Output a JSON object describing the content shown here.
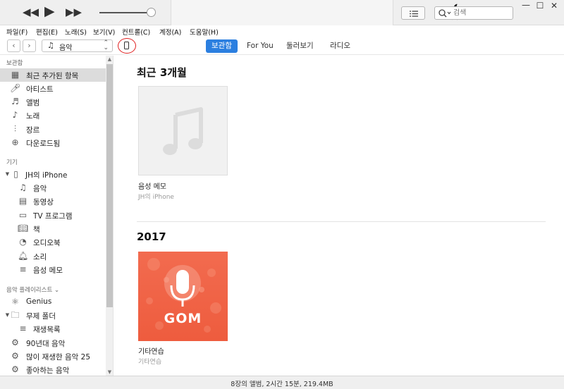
{
  "player": {
    "rewind_icon": "rewind-icon",
    "play_icon": "play-icon",
    "forward_icon": "fast-forward-icon",
    "volume_level": 0.9
  },
  "search": {
    "placeholder": "검색"
  },
  "window": {
    "minimize": "—",
    "maximize": "☐",
    "close": "✕"
  },
  "menu": [
    "파일(F)",
    "편집(E)",
    "노래(S)",
    "보기(V)",
    "컨트롤(C)",
    "계정(A)",
    "도움말(H)"
  ],
  "nav": {
    "back": "‹",
    "forward": "›",
    "media_type": "음악",
    "tabs": [
      "보관함",
      "For You",
      "둘러보기",
      "라디오"
    ],
    "active_tab": "보관함"
  },
  "sidebar": {
    "library_header": "보관함",
    "library_items": [
      {
        "label": "최근 추가된 항목",
        "icon": "grid-icon",
        "selected": true
      },
      {
        "label": "아티스트",
        "icon": "microphone-icon"
      },
      {
        "label": "앨범",
        "icon": "album-icon"
      },
      {
        "label": "노래",
        "icon": "music-note-icon"
      },
      {
        "label": "장르",
        "icon": "genre-icon"
      },
      {
        "label": "다운로드됨",
        "icon": "download-icon"
      }
    ],
    "devices_header": "기기",
    "device_name": "JH의 iPhone",
    "device_items": [
      {
        "label": "음악",
        "icon": "music-note-icon"
      },
      {
        "label": "동영상",
        "icon": "film-icon"
      },
      {
        "label": "TV 프로그램",
        "icon": "tv-icon"
      },
      {
        "label": "책",
        "icon": "book-icon"
      },
      {
        "label": "오디오북",
        "icon": "audiobook-icon"
      },
      {
        "label": "소리",
        "icon": "bell-icon"
      },
      {
        "label": "음성 메모",
        "icon": "voice-memo-icon"
      }
    ],
    "playlists_header": "음악 플레이리스트 ⌄",
    "playlist_items": [
      {
        "label": "Genius",
        "icon": "genius-icon"
      },
      {
        "label": "무제 폴더",
        "icon": "folder-icon"
      },
      {
        "label": "재생목록",
        "icon": "playlist-icon"
      },
      {
        "label": "90년대 음악",
        "icon": "gear-icon"
      },
      {
        "label": "많이 재생한 음악 25",
        "icon": "gear-icon"
      },
      {
        "label": "좋아하는 음악",
        "icon": "gear-icon"
      }
    ]
  },
  "main": {
    "sections": [
      {
        "title": "최근 3개월",
        "album": {
          "title": "음성 메모",
          "subtitle": "JH의 iPhone"
        }
      },
      {
        "title": "2017",
        "album": {
          "title": "기타연습",
          "subtitle": "기타연습",
          "art_text": "GOM"
        }
      }
    ]
  },
  "status": "8장의 앨범, 2시간 15분, 219.4MB",
  "colors": {
    "accent": "#2b7fe0",
    "gom_art": "#f06548",
    "device_highlight": "#e02020"
  }
}
